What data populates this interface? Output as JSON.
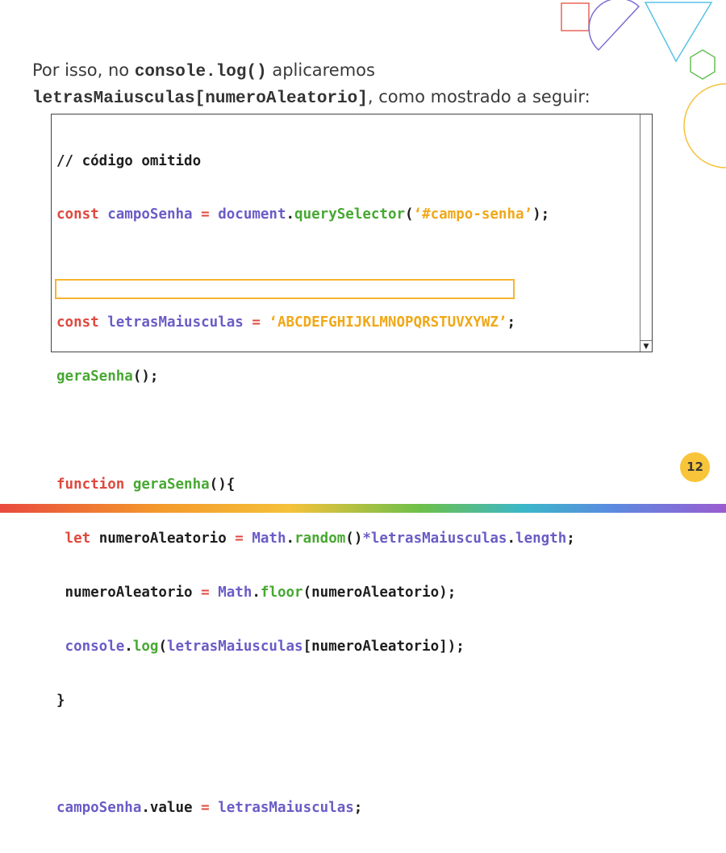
{
  "intro": {
    "part1": "Por isso, no ",
    "code1": "console.log()",
    "part2": " aplicaremos",
    "code2": "letrasMaiusculas[numeroAleatorio]",
    "part3": ", como mostrado a seguir:"
  },
  "code": {
    "l1": {
      "a": "// código omitido"
    },
    "l2": {
      "a": "const",
      "b": " campoSenha ",
      "c": "=",
      "d": " document",
      "e": ".",
      "f": "querySelector",
      "g": "(",
      "h": "‘#campo-senha’",
      "i": ");"
    },
    "l4": {
      "a": "const",
      "b": " letrasMaiusculas ",
      "c": "=",
      "d": " ‘ABCDEFGHIJKLMNOPQRSTUVXYWZ’",
      "e": ";"
    },
    "l5": {
      "a": "geraSenha",
      "b": "();"
    },
    "l7": {
      "a": "function",
      "b": " geraSenha",
      "c": "(){"
    },
    "l8": {
      "a": " let",
      "b": " numeroAleatorio ",
      "c": "=",
      "d": " Math",
      "e": ".",
      "f": "random",
      "g": "()",
      "h": "*letrasMaiusculas",
      "i": ".",
      "j": "length",
      "k": ";"
    },
    "l9": {
      "a": " numeroAleatorio ",
      "b": "=",
      "c": " Math",
      "d": ".",
      "e": "floor",
      "f": "(numeroAleatorio);"
    },
    "l10": {
      "a": " console",
      "b": ".",
      "c": "log",
      "d": "(",
      "e": "letrasMaiusculas",
      "f": "[numeroAleatorio]);"
    },
    "l11": {
      "a": "}"
    },
    "l13": {
      "a": "campoSenha",
      "b": ".value ",
      "c": "=",
      "d": " letrasMaiusculas",
      "e": ";"
    }
  },
  "page_number": "12",
  "colors": {
    "keyword": "#e0483e",
    "variable": "#6a5cc6",
    "string": "#f0a818",
    "function": "#47a832",
    "highlight": "#f5b52e",
    "page_badge": "#f8c53a"
  }
}
